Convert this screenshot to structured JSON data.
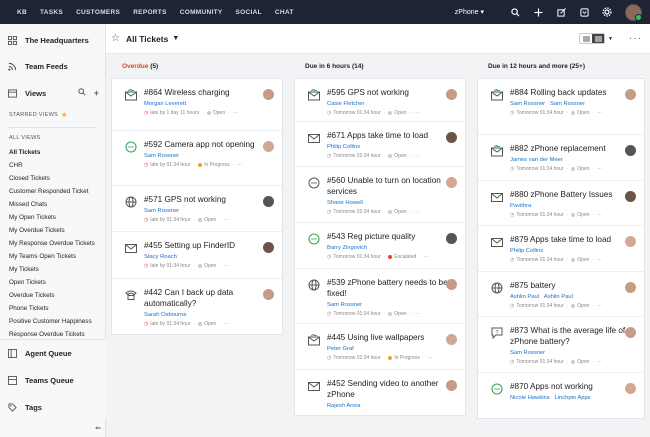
{
  "nav": {
    "items": [
      "KB",
      "TASKS",
      "CUSTOMERS",
      "REPORTS",
      "COMMUNITY",
      "SOCIAL",
      "CHAT"
    ],
    "department": "zPhone"
  },
  "sidebar": {
    "headquarters": "The Headquarters",
    "team_feeds": "Team Feeds",
    "views": "Views",
    "starred_views": "STARRED VIEWS",
    "all_views": "ALL VIEWS",
    "view_items": [
      "All Tickets",
      "CHR",
      "Closed Tickets",
      "Customer Responded Ticket",
      "Missed Chats",
      "My Open Tickets",
      "My Overdue Tickets",
      "My Response Overdue Tickets",
      "My Teams Open Tickets",
      "My Tickets",
      "Open Tickets",
      "Overdue Tickets",
      "Phone Tickets",
      "Positive Customer Happiness",
      "Response Overdue Tickets"
    ],
    "agent_queue": "Agent Queue",
    "teams_queue": "Teams Queue",
    "tags": "Tags"
  },
  "header": {
    "title": "All Tickets"
  },
  "colors": {
    "overdue": "#e0452b",
    "link": "#1a6fc7",
    "nav_bg": "#1e2433",
    "open": "#c9ccd2",
    "in_progress": "#f0a030",
    "escalated": "#e0452b"
  },
  "columns": [
    {
      "label": "Overdue",
      "count": "(5)",
      "cards": [
        {
          "icon": "email-reply-icon",
          "subject": "#864 Wireless charging",
          "assignee": "Morgan Leverett",
          "late": "late by 1 day 11 hours",
          "status": "Open"
        },
        {
          "icon": "chat-icon",
          "subject": "#592 Camera app not opening",
          "assignee": "Sam Rossner",
          "late": "late by 01:34 hour",
          "status": "In Progress"
        },
        {
          "icon": "globe-icon",
          "subject": "#571 GPS not working",
          "assignee": "Sam Rossner",
          "late": "late by 01:34 hour",
          "status": "Open"
        },
        {
          "icon": "email-icon",
          "subject": "#455 Setting up FinderID",
          "assignee": "Stacy Roach",
          "late": "late by 01:34 hour",
          "status": "Open"
        },
        {
          "icon": "phone-icon",
          "subject": "#442 Can I back up data automatically?",
          "assignee": "Sarah Osbourne",
          "late": "late by 01:34 hour",
          "status": "Open"
        }
      ]
    },
    {
      "label": "Due in 6 hours",
      "count": "(14)",
      "cards": [
        {
          "icon": "email-reply-icon",
          "subject": "#595 GPS not working",
          "assignee": "Casie Fletcher",
          "late": "Tomorrow 01:34 hour",
          "status": "Open"
        },
        {
          "icon": "email-icon",
          "subject": "#671 Apps take time to load",
          "assignee": "Philip Collins",
          "late": "Tomorrow 01:34 hour",
          "status": "Open"
        },
        {
          "icon": "chat-icon",
          "subject": "#560 Unable to turn on location services",
          "assignee": "Shane Howell",
          "late": "Tomorrow 01:34 hour",
          "status": "Open"
        },
        {
          "icon": "chat-icon",
          "subject": "#543 Reg picture quality",
          "assignee": "Barry Zingovich",
          "late": "Tomorrow 01:34 hour",
          "status": "Escalated"
        },
        {
          "icon": "globe-icon",
          "subject": "#539 zPhone battery needs to be fixed!",
          "assignee": "Sam Rossner",
          "late": "Tomorrow 01:34 hour",
          "status": "Open"
        },
        {
          "icon": "email-reply-icon",
          "subject": "#445 Using live wallpapers",
          "assignee": "Peter Graf",
          "late": "Tomorrow 01:34 hour",
          "status": "In Progress"
        },
        {
          "icon": "email-icon",
          "subject": "#452 Sending video to another zPhone",
          "assignee": "Rajesh Arora",
          "late": "",
          "status": ""
        }
      ]
    },
    {
      "label": "Due in 12 hours and more",
      "count": "(25+)",
      "cards": [
        {
          "icon": "email-reply-icon",
          "subject": "#884 Rolling back updates",
          "assignee": "Sam Rossner",
          "assignee2": "Sam Rossner",
          "late": "Tomorrow 01:34 hour",
          "status": "Open"
        },
        {
          "icon": "email-reply-icon",
          "subject": "#882 zPhone replacement",
          "assignee": "James van der Meer",
          "late": "Tomorrow 01:34 hour",
          "status": "Open"
        },
        {
          "icon": "email-icon",
          "subject": "#880 zPhone Battery Issues",
          "assignee": "Pavithra",
          "late": "Tomorrow 01:34 hour",
          "status": "Open"
        },
        {
          "icon": "email-icon",
          "subject": "#879 Apps take time to load",
          "assignee": "Philip Collins",
          "late": "Tomorrow 01:34 hour",
          "status": "Open"
        },
        {
          "icon": "globe-icon",
          "subject": "#875 battery",
          "assignee": "Ashlin Paul",
          "assignee2": "Ashlin Paul",
          "late": "Tomorrow 01:34 hour",
          "status": "Open"
        },
        {
          "icon": "question-icon",
          "subject": "#873 What is the average life of a zPhone battery?",
          "assignee": "Sam Rossner",
          "late": "Tomorrow 01:34 hour",
          "status": "Open"
        },
        {
          "icon": "chat-icon",
          "subject": "#870 Apps not working",
          "assignee": "Nicole Hawkins",
          "assignee2": "Linchpin Apps",
          "late": "Tomorrow 01:34 hour",
          "status": "Open"
        }
      ]
    }
  ]
}
